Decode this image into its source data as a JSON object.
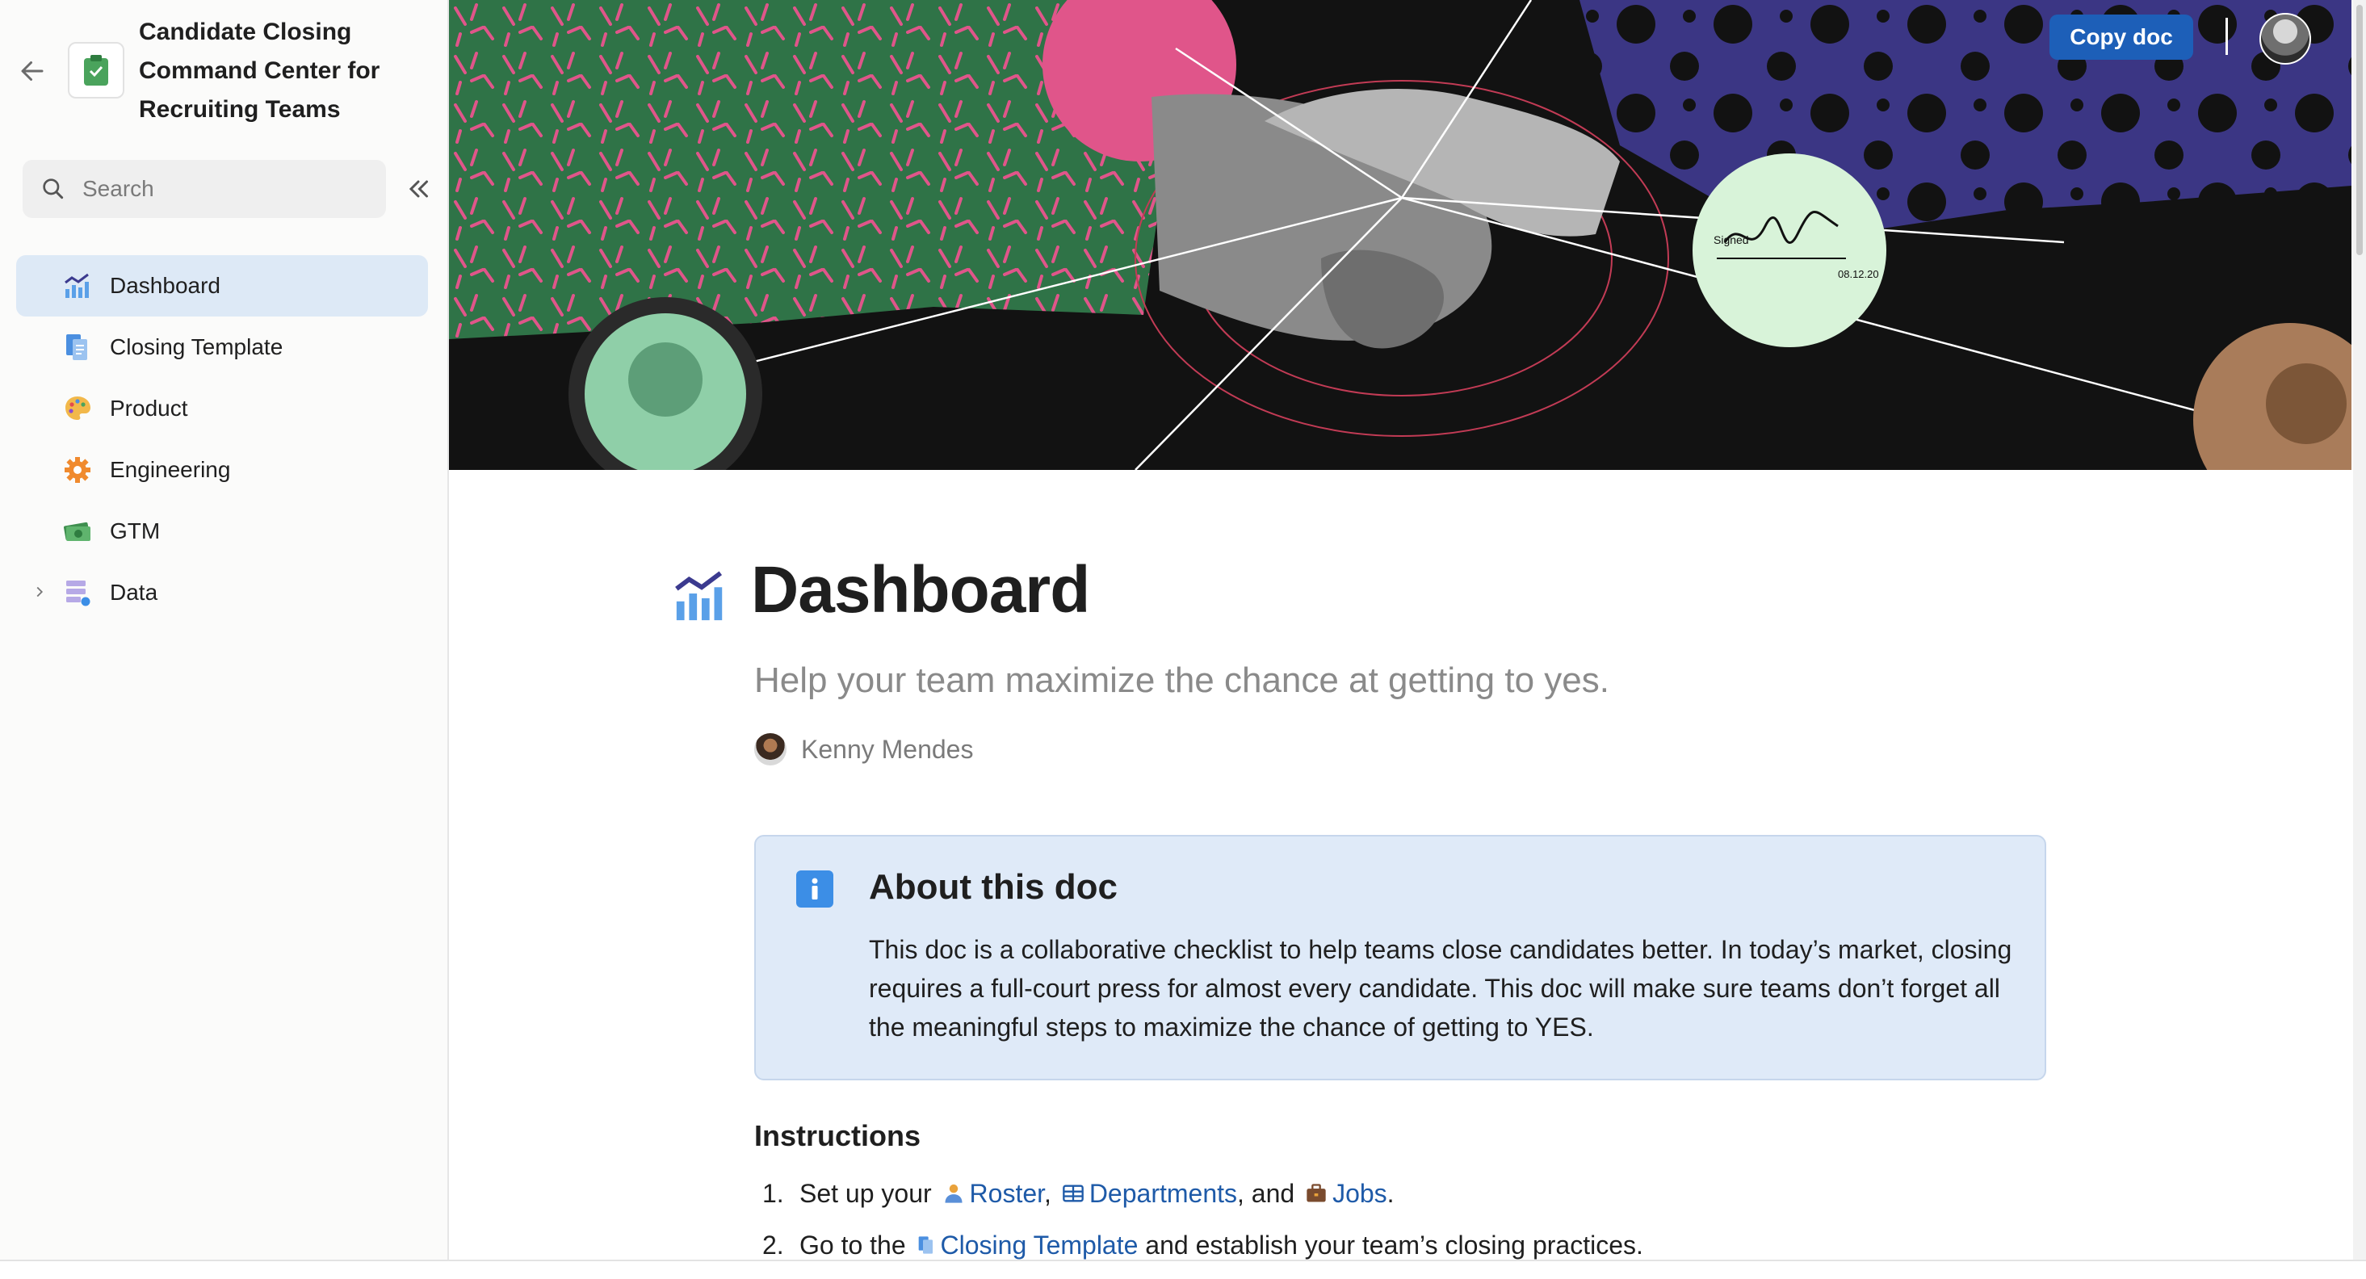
{
  "sidebar": {
    "doc_title": "Candidate Closing Command Center for Recruiting Teams",
    "search_placeholder": "Search",
    "items": [
      {
        "label": "Dashboard",
        "icon": "chart-icon",
        "active": true
      },
      {
        "label": "Closing Template",
        "icon": "document-icon"
      },
      {
        "label": "Product",
        "icon": "palette-icon"
      },
      {
        "label": "Engineering",
        "icon": "gear-icon"
      },
      {
        "label": "GTM",
        "icon": "money-icon"
      },
      {
        "label": "Data",
        "icon": "database-icon",
        "expandable": true
      }
    ]
  },
  "header": {
    "copy_doc_label": "Copy doc"
  },
  "page": {
    "title": "Dashboard",
    "subtitle": "Help your team maximize the chance at getting to yes.",
    "author": "Kenny Mendes",
    "callout": {
      "title": "About this doc",
      "body": "This doc is a collaborative checklist to help teams close candidates better. In today’s market, closing requires a full-court press for almost every candidate. This doc will make sure teams don’t forget all the meaningful steps to maximize the chance of getting to YES."
    },
    "instructions": {
      "title": "Instructions",
      "step1": {
        "num": "1.",
        "prefix": "Set up your",
        "roster": "Roster",
        "sep1": ",",
        "departments": "Departments",
        "sep2": ", and",
        "jobs": "Jobs",
        "end": "."
      },
      "step2": {
        "num": "2.",
        "prefix": "Go to the",
        "template": "Closing Template",
        "suffix": "and establish your team’s closing practices."
      }
    }
  },
  "banner": {
    "signature_label": "Signed",
    "signature_date": "08.12.20"
  },
  "colors": {
    "accent": "#1d5fb8",
    "active_nav": "#dde9f6",
    "callout_bg": "#dfeaf8",
    "link": "#1e5aa8"
  }
}
